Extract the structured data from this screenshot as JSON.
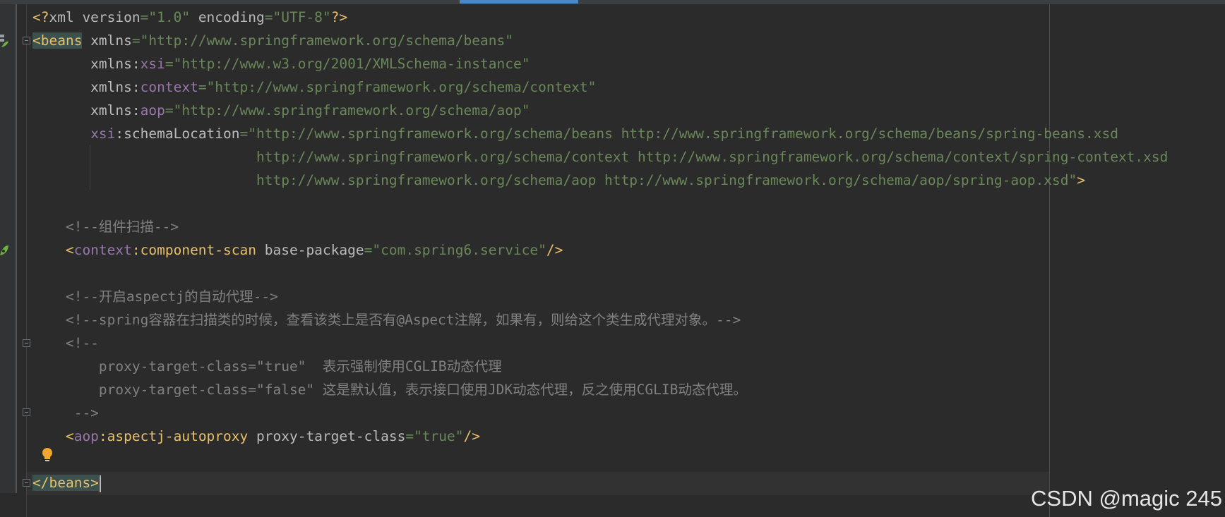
{
  "colors": {
    "background": "#2b2b2b",
    "tag": "#e8bf6a",
    "attribute": "#bababa",
    "namespace": "#9876aa",
    "string": "#6a8759",
    "comment": "#808080",
    "text": "#a9b7c6",
    "tab_indicator": "#4a88c7"
  },
  "icons": {
    "spring_bean": "spring-bean-gutter-icon",
    "intention": "lightbulb-icon",
    "fold": "fold-marker-icon"
  },
  "editor": {
    "lines": [
      {
        "tokens": [
          {
            "t": "<?",
            "c": "tag"
          },
          {
            "t": "xml version",
            "c": "attribute"
          },
          {
            "t": "=\"1.0\" ",
            "c": "string"
          },
          {
            "t": "encoding",
            "c": "attribute"
          },
          {
            "t": "=\"UTF-8\"",
            "c": "string"
          },
          {
            "t": "?>",
            "c": "tag"
          }
        ]
      },
      {
        "tokens": [
          {
            "t": "<beans",
            "c": "tag",
            "hl": true
          },
          {
            "t": " xmlns",
            "c": "attribute"
          },
          {
            "t": "=\"http://www.springframework.org/schema/beans\"",
            "c": "string"
          }
        ]
      },
      {
        "tokens": [
          {
            "t": "       xmlns",
            "c": "attribute"
          },
          {
            "t": ":",
            "c": "attribute"
          },
          {
            "t": "xsi",
            "c": "namespace"
          },
          {
            "t": "=\"http://www.w3.org/2001/XMLSchema-instance\"",
            "c": "string"
          }
        ]
      },
      {
        "tokens": [
          {
            "t": "       xmlns",
            "c": "attribute"
          },
          {
            "t": ":",
            "c": "attribute"
          },
          {
            "t": "context",
            "c": "namespace"
          },
          {
            "t": "=\"http://www.springframework.org/schema/context\"",
            "c": "string"
          }
        ]
      },
      {
        "tokens": [
          {
            "t": "       xmlns",
            "c": "attribute"
          },
          {
            "t": ":",
            "c": "attribute"
          },
          {
            "t": "aop",
            "c": "namespace"
          },
          {
            "t": "=\"http://www.springframework.org/schema/aop\"",
            "c": "string"
          }
        ]
      },
      {
        "tokens": [
          {
            "t": "       ",
            "c": "attribute"
          },
          {
            "t": "xsi",
            "c": "namespace"
          },
          {
            "t": ":schemaLocation",
            "c": "attribute"
          },
          {
            "t": "=\"http://www.springframework.org/schema/beans http://www.springframework.org/schema/beans/spring-beans.xsd",
            "c": "string"
          }
        ]
      },
      {
        "tokens": [
          {
            "t": "                           http://www.springframework.org/schema/context http://www.springframework.org/schema/context/spring-context.xsd",
            "c": "string"
          }
        ]
      },
      {
        "tokens": [
          {
            "t": "                           http://www.springframework.org/schema/aop http://www.springframework.org/schema/aop/spring-aop.xsd\"",
            "c": "string"
          },
          {
            "t": ">",
            "c": "tag"
          }
        ]
      },
      {
        "tokens": []
      },
      {
        "tokens": [
          {
            "t": "    <!--组件扫描-->",
            "c": "comment"
          }
        ]
      },
      {
        "tokens": [
          {
            "t": "    <",
            "c": "tag"
          },
          {
            "t": "context",
            "c": "namespace"
          },
          {
            "t": ":component-scan",
            "c": "tag"
          },
          {
            "t": " base-package",
            "c": "attribute"
          },
          {
            "t": "=\"com.spring6.service\"",
            "c": "string"
          },
          {
            "t": "/>",
            "c": "tag"
          }
        ]
      },
      {
        "tokens": []
      },
      {
        "tokens": [
          {
            "t": "    <!--开启aspectj的自动代理-->",
            "c": "comment"
          }
        ]
      },
      {
        "tokens": [
          {
            "t": "    <!--spring容器在扫描类的时候，查看该类上是否有@Aspect注解，如果有，则给这个类生成代理对象。-->",
            "c": "comment"
          }
        ]
      },
      {
        "tokens": [
          {
            "t": "    <!--",
            "c": "comment"
          }
        ]
      },
      {
        "tokens": [
          {
            "t": "        proxy-target-class=\"true\"  表示强制使用CGLIB动态代理",
            "c": "comment"
          }
        ]
      },
      {
        "tokens": [
          {
            "t": "        proxy-target-class=\"false\" 这是默认值，表示接口使用JDK动态代理，反之使用CGLIB动态代理。",
            "c": "comment"
          }
        ]
      },
      {
        "tokens": [
          {
            "t": "     -->",
            "c": "comment"
          }
        ]
      },
      {
        "tokens": [
          {
            "t": "    <",
            "c": "tag"
          },
          {
            "t": "aop",
            "c": "namespace"
          },
          {
            "t": ":aspectj-autoproxy",
            "c": "tag"
          },
          {
            "t": " proxy-target-class",
            "c": "attribute"
          },
          {
            "t": "=\"true\"",
            "c": "string"
          },
          {
            "t": "/>",
            "c": "tag"
          }
        ]
      },
      {
        "tokens": []
      },
      {
        "tokens": [
          {
            "t": "</beans>",
            "c": "tag",
            "hl": true,
            "caret": true
          }
        ]
      }
    ]
  },
  "watermark": {
    "text": "CSDN @magic 245"
  }
}
